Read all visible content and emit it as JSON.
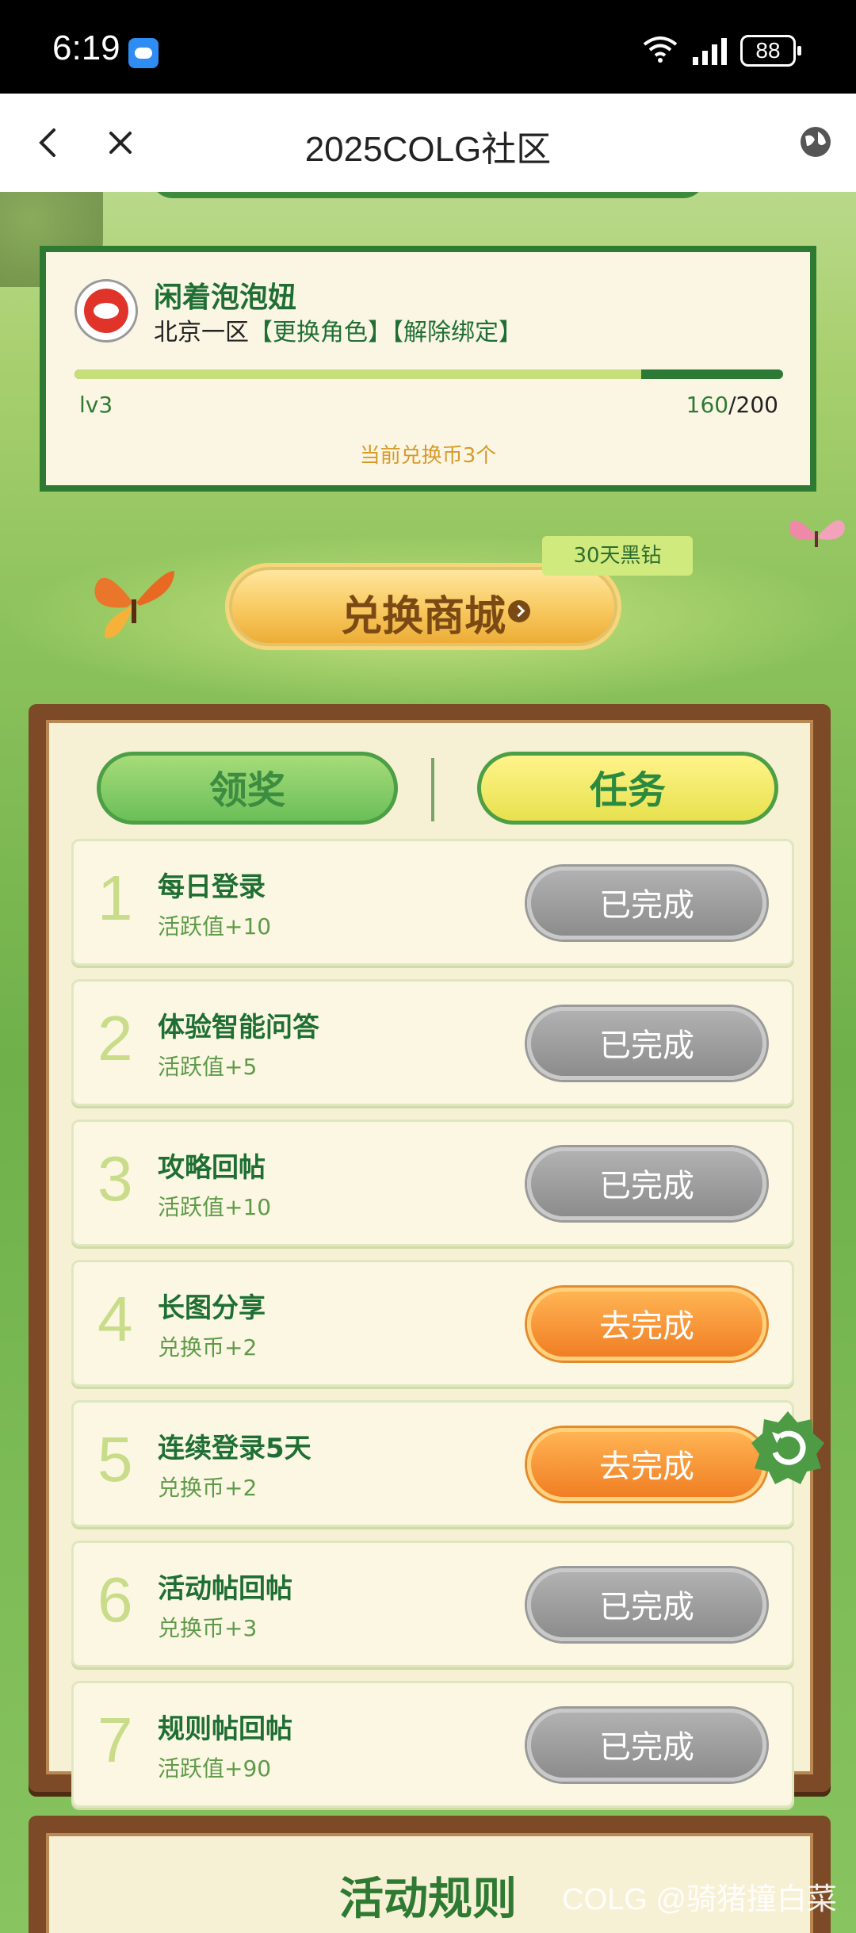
{
  "status_bar": {
    "time": "6:19",
    "battery": "88"
  },
  "nav": {
    "title": "2025COLG社区"
  },
  "user": {
    "name": "闲着泡泡妞",
    "server": "北京一区",
    "change_role": "【更换角色】",
    "unbind": "【解除绑定】",
    "level": "lv3",
    "exp_current": "160",
    "exp_total": "/200",
    "progress_fraction": 0.8,
    "coins_text": "当前兑换币3个"
  },
  "shop": {
    "label": "兑换商城",
    "badge": "30天黑钻"
  },
  "tabs": {
    "reward": "领奖",
    "task": "任务",
    "active": "task"
  },
  "tasks": [
    {
      "num": "1",
      "name": "每日登录",
      "reward": "活跃值+10",
      "button": "已完成",
      "state": "done"
    },
    {
      "num": "2",
      "name": "体验智能问答",
      "reward": "活跃值+5",
      "button": "已完成",
      "state": "done"
    },
    {
      "num": "3",
      "name": "攻略回帖",
      "reward": "活跃值+10",
      "button": "已完成",
      "state": "done"
    },
    {
      "num": "4",
      "name": "长图分享",
      "reward": "兑换币+2",
      "button": "去完成",
      "state": "todo"
    },
    {
      "num": "5",
      "name": "连续登录5天",
      "reward": "兑换币+2",
      "button": "去完成",
      "state": "todo"
    },
    {
      "num": "6",
      "name": "活动帖回帖",
      "reward": "兑换币+3",
      "button": "已完成",
      "state": "done"
    },
    {
      "num": "7",
      "name": "规则帖回帖",
      "reward": "活跃值+90",
      "button": "已完成",
      "state": "done"
    }
  ],
  "rules": {
    "title": "活动规则"
  },
  "watermark": "COLG @骑猪撞白菜",
  "colors": {
    "primary_green": "#1f6f34",
    "done_gray": "#8c8c8c",
    "todo_orange": "#f07e24",
    "gold": "#d79a2b"
  }
}
